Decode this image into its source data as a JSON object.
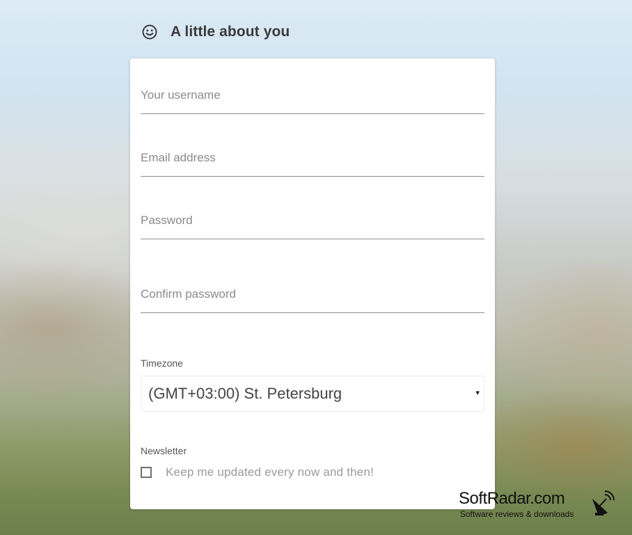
{
  "header": {
    "icon": "smile-icon",
    "title": "A little about you"
  },
  "form": {
    "username": {
      "placeholder": "Your username",
      "value": ""
    },
    "email": {
      "placeholder": "Email address",
      "value": ""
    },
    "password": {
      "placeholder": "Password",
      "value": ""
    },
    "confirm_password": {
      "placeholder": "Confirm password",
      "value": ""
    },
    "timezone": {
      "label": "Timezone",
      "selected": "(GMT+03:00) St. Petersburg",
      "caret": "▾"
    },
    "newsletter": {
      "label": "Newsletter",
      "checkbox_label": "Keep me updated every now and then!",
      "checked": false
    }
  },
  "watermark": {
    "title": "SoftRadar.com",
    "subtitle": "Software reviews & downloads",
    "icon": "satellite-dish-icon"
  }
}
